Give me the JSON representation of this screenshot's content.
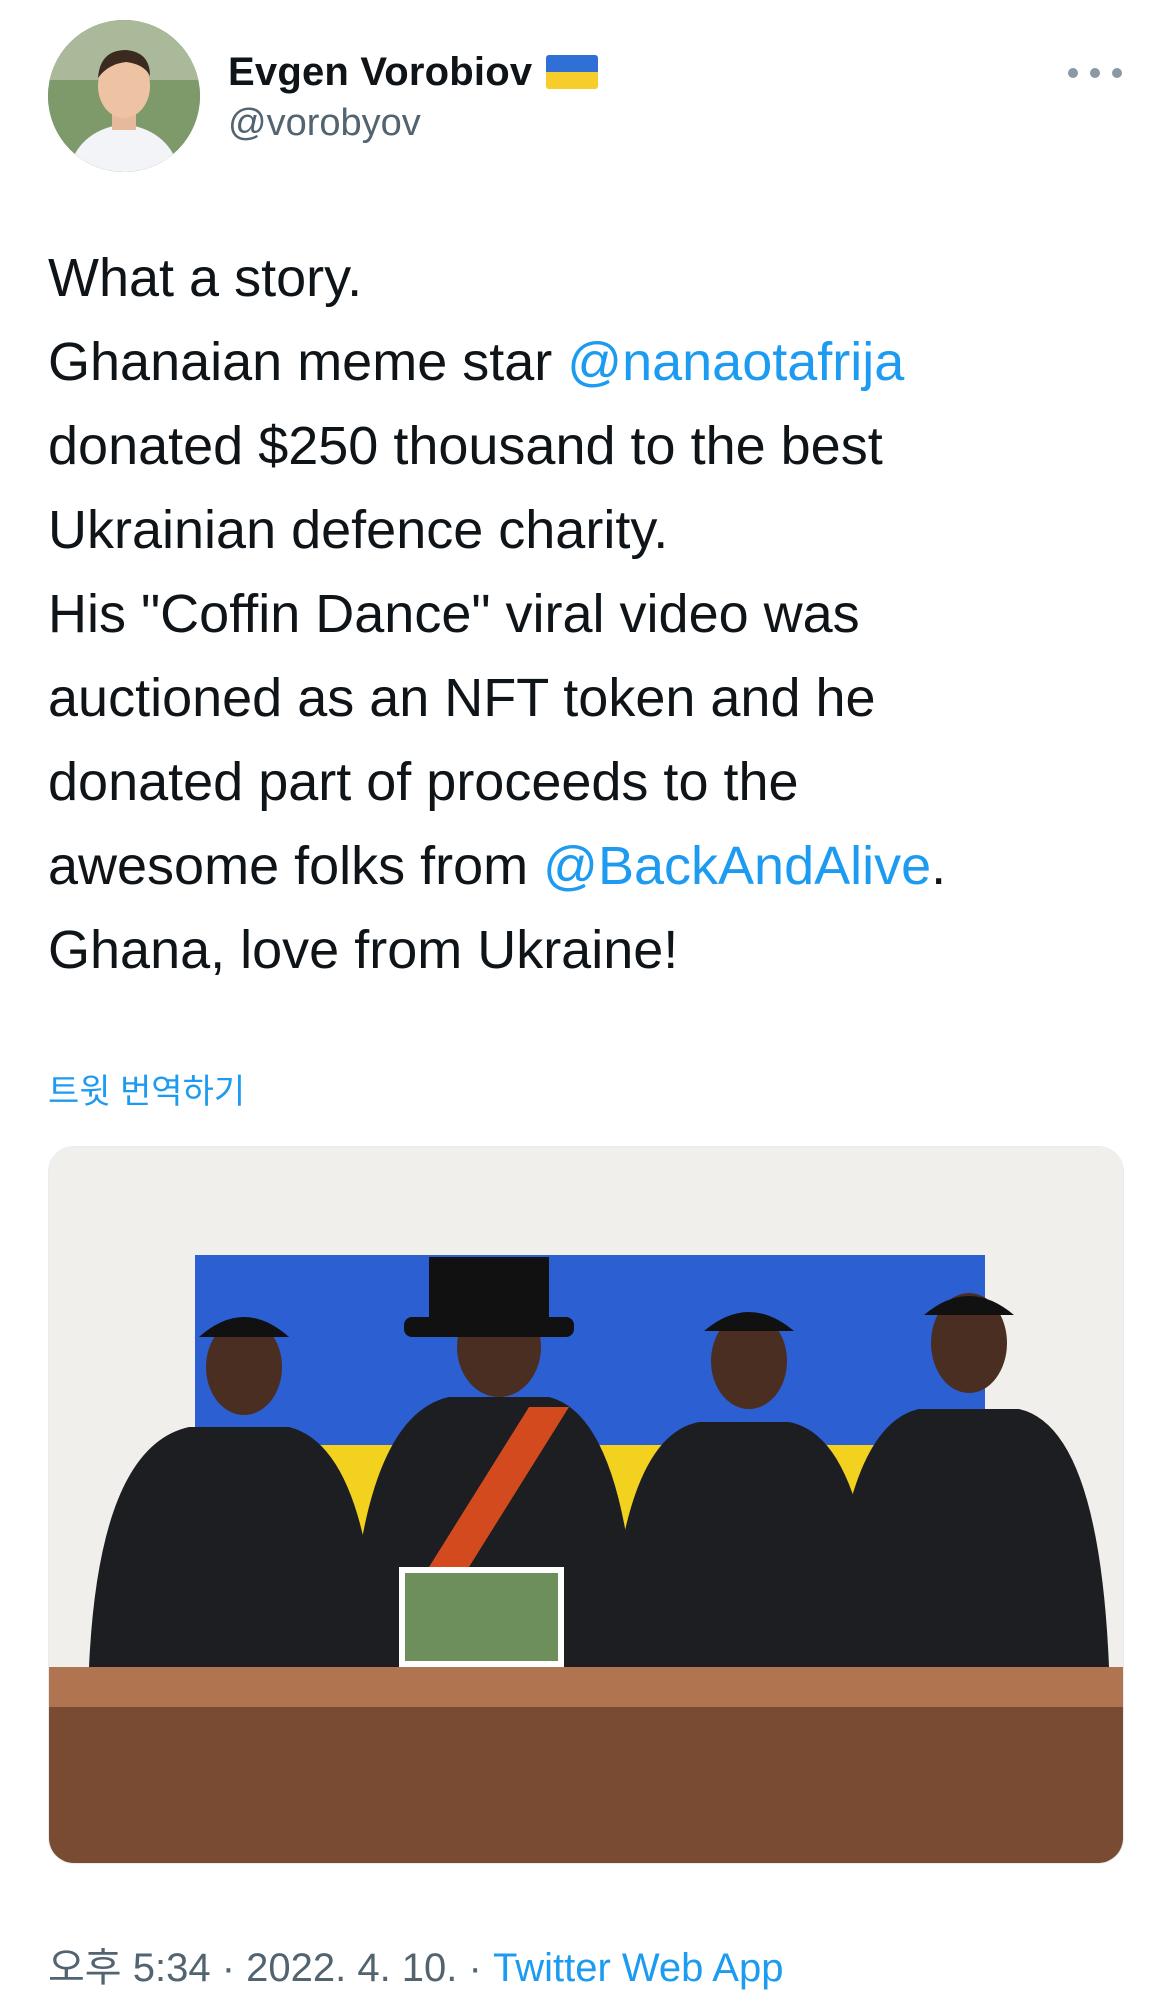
{
  "author": {
    "display_name": "Evgen Vorobiov",
    "handle": "@vorobyov",
    "flag_icon": "ukraine-flag-icon"
  },
  "tweet": {
    "lines": [
      [
        {
          "text": "What a story."
        }
      ],
      [
        {
          "text": "Ghanaian meme star "
        },
        {
          "text": "@nanaotafrija",
          "mention": true
        }
      ],
      [
        {
          "text": "donated $250 thousand to the best"
        }
      ],
      [
        {
          "text": "Ukrainian defence charity."
        }
      ],
      [
        {
          "text": "His \"Coffin Dance\" viral video was"
        }
      ],
      [
        {
          "text": "auctioned as an NFT token and he"
        }
      ],
      [
        {
          "text": "donated part of proceeds to the"
        }
      ],
      [
        {
          "text": "awesome folks from "
        },
        {
          "text": "@BackAndAlive",
          "mention": true
        },
        {
          "text": "."
        }
      ],
      [
        {
          "text": "Ghana, love from Ukraine!"
        }
      ]
    ],
    "translate_label": "트윗 번역하기"
  },
  "meta": {
    "time": "오후 5:34",
    "separator": " · ",
    "date": "2022. 4. 10.",
    "source": "Twitter Web App"
  },
  "colors": {
    "link": "#1d9bf0",
    "secondary": "#536471",
    "flag_blue": "#2f6fd6",
    "flag_yellow": "#f6cd2a"
  }
}
